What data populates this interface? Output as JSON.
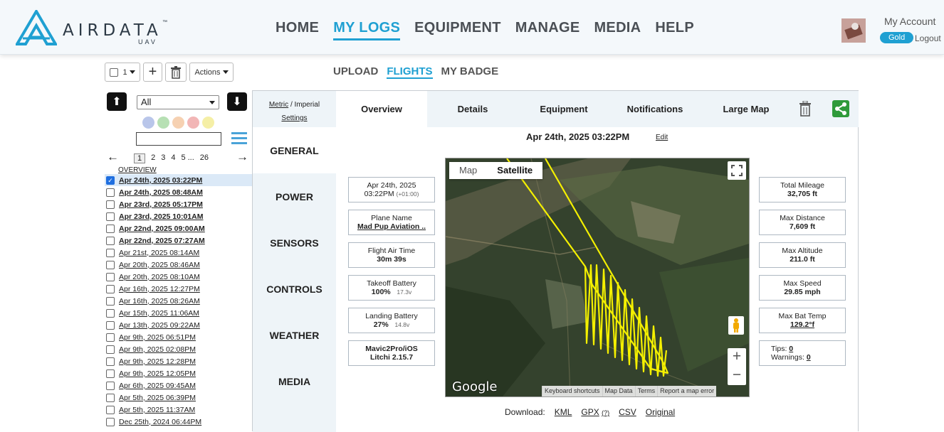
{
  "brand": {
    "name": "AIRDATA",
    "sub": "UAV",
    "tm": "™"
  },
  "nav": [
    "HOME",
    "MY LOGS",
    "EQUIPMENT",
    "MANAGE",
    "MEDIA",
    "HELP"
  ],
  "account": {
    "title": "My Account",
    "tier": "Gold",
    "logout": "Logout"
  },
  "toolbar": {
    "select_count": "1",
    "actions": "Actions"
  },
  "subnav": [
    "UPLOAD",
    "FLIGHTS",
    "MY BADGE"
  ],
  "sidebar": {
    "filter": "All",
    "dot_colors": [
      "#b9c6ea",
      "#b7e0b4",
      "#f6d1b2",
      "#f2b6b6",
      "#f5efa6"
    ],
    "pager": {
      "pages": [
        "1",
        "2",
        "3",
        "4",
        "5",
        "...",
        "26"
      ]
    },
    "overview": "OVERVIEW",
    "flights": [
      {
        "label": "Apr 24th, 2025 03:22PM",
        "bold": true,
        "checked": true
      },
      {
        "label": "Apr 24th, 2025 08:48AM",
        "bold": true
      },
      {
        "label": "Apr 23rd, 2025 05:17PM",
        "bold": true
      },
      {
        "label": "Apr 23rd, 2025 10:01AM",
        "bold": true
      },
      {
        "label": "Apr 22nd, 2025 09:00AM",
        "bold": true
      },
      {
        "label": "Apr 22nd, 2025 07:27AM",
        "bold": true
      },
      {
        "label": "Apr 21st, 2025 08:14AM"
      },
      {
        "label": "Apr 20th, 2025 08:46AM"
      },
      {
        "label": "Apr 20th, 2025 08:10AM"
      },
      {
        "label": "Apr 16th, 2025 12:27PM"
      },
      {
        "label": "Apr 16th, 2025 08:26AM"
      },
      {
        "label": "Apr 15th, 2025 11:06AM"
      },
      {
        "label": "Apr 13th, 2025 09:22AM"
      },
      {
        "label": "Apr 9th, 2025 06:51PM"
      },
      {
        "label": "Apr 9th, 2025 02:08PM"
      },
      {
        "label": "Apr 9th, 2025 12:28PM"
      },
      {
        "label": "Apr 9th, 2025 12:05PM"
      },
      {
        "label": "Apr 6th, 2025 09:45AM"
      },
      {
        "label": "Apr 5th, 2025 06:39PM"
      },
      {
        "label": "Apr 5th, 2025 11:37AM"
      },
      {
        "label": "Dec 25th, 2024 06:44PM"
      }
    ]
  },
  "panel": {
    "units": {
      "metric": "Metric",
      "sep": "/",
      "imperial": "Imperial",
      "settings": "Settings"
    },
    "sections": [
      "GENERAL",
      "POWER",
      "SENSORS",
      "CONTROLS",
      "WEATHER",
      "MEDIA"
    ],
    "tabs": [
      "Overview",
      "Details",
      "Equipment",
      "Notifications",
      "Large Map"
    ],
    "date": "Apr 24th, 2025 03:22PM",
    "edit": "Edit",
    "left_cards": [
      {
        "label": "Apr 24th, 2025",
        "value": "03:22PM",
        "small": "(+01:00)"
      },
      {
        "label": "Plane Name",
        "value": "Mad Pup Aviation ..",
        "link": true
      },
      {
        "label": "Flight Air Time",
        "value": "30m 39s"
      },
      {
        "label": "Takeoff Battery",
        "value": "100%",
        "small": "17.3v"
      },
      {
        "label": "Landing Battery",
        "value": "27%",
        "small": "14.8v"
      },
      {
        "label": "Mavic2Pro/iOS",
        "value": "Litchi 2.15.7"
      }
    ],
    "right_cards": [
      {
        "label": "Total Mileage",
        "value": "32,705 ft"
      },
      {
        "label": "Max Distance",
        "value": "7,609 ft"
      },
      {
        "label": "Max Altitude",
        "value": "211.0 ft"
      },
      {
        "label": "Max Speed",
        "value": "29.85 mph"
      },
      {
        "label": "Max Bat Temp",
        "value": "129.2°f",
        "link": true
      },
      {
        "tips_label": "Tips:",
        "tips": "0",
        "warn_label": "Warnings:",
        "warnings": "0"
      }
    ],
    "map": {
      "toggle": [
        "Map",
        "Satellite"
      ],
      "google": "Google",
      "attribution": [
        "Keyboard shortcuts",
        "Map Data",
        "Terms",
        "Report a map error"
      ],
      "path_color": "#f4f000"
    },
    "download": {
      "label": "Download:",
      "links": [
        "KML",
        "GPX",
        "CSV",
        "Original"
      ],
      "help": "(?)"
    }
  }
}
